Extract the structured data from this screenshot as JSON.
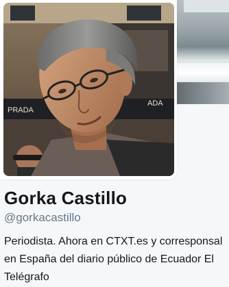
{
  "profile": {
    "display_name": "Gorka Castillo",
    "handle": "@gorkacastillo",
    "bio": "Periodista. Ahora en CTXT.es y corresponsal en España del diario público de Ecuador El Telégrafo"
  },
  "avatar": {
    "storefront_text": "PRADA",
    "storefront_text_2": "ADA"
  },
  "colors": {
    "background": "#f5f8fa",
    "name": "#14171a",
    "handle": "#657786"
  }
}
